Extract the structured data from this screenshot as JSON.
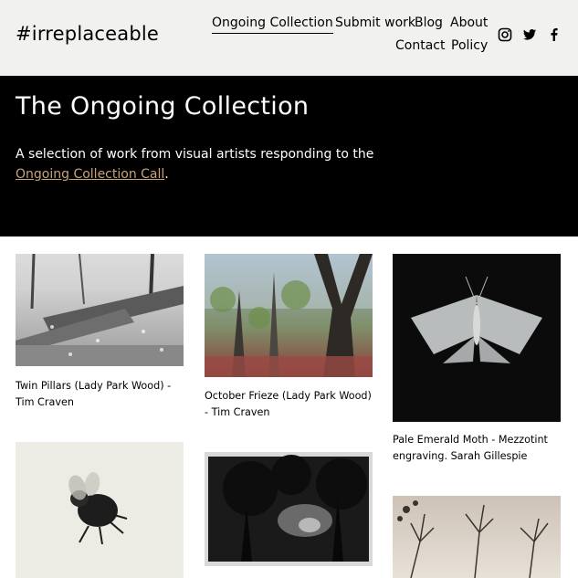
{
  "header": {
    "logo": "#irreplaceable",
    "nav": [
      {
        "label": "Ongoing Collection",
        "active": true
      },
      {
        "label": "Submit work"
      },
      {
        "label": "Blog"
      },
      {
        "label": "About"
      },
      {
        "label": "Contact"
      },
      {
        "label": "Policy"
      }
    ],
    "social": [
      "instagram-icon",
      "twitter-icon",
      "facebook-icon"
    ]
  },
  "hero": {
    "title": "The Ongoing Collection",
    "intro": "A selection of work from visual artists responding to the ",
    "link_text": "Ongoing Collection Call",
    "suffix": "."
  },
  "gallery": [
    {
      "caption": "Twin Pillars (Lady Park Wood) - Tim Craven"
    },
    {
      "caption": "October Frieze (Lady Park Wood) - Tim Craven"
    },
    {
      "caption": "Pale Emerald Moth - Mezzotint engraving. Sarah Gillespie"
    },
    {
      "caption": ""
    },
    {
      "caption": ""
    },
    {
      "caption": ""
    }
  ],
  "colors": {
    "header_bg": "#f1f1ef",
    "hero_bg": "#000000",
    "link": "#c9a27a"
  }
}
